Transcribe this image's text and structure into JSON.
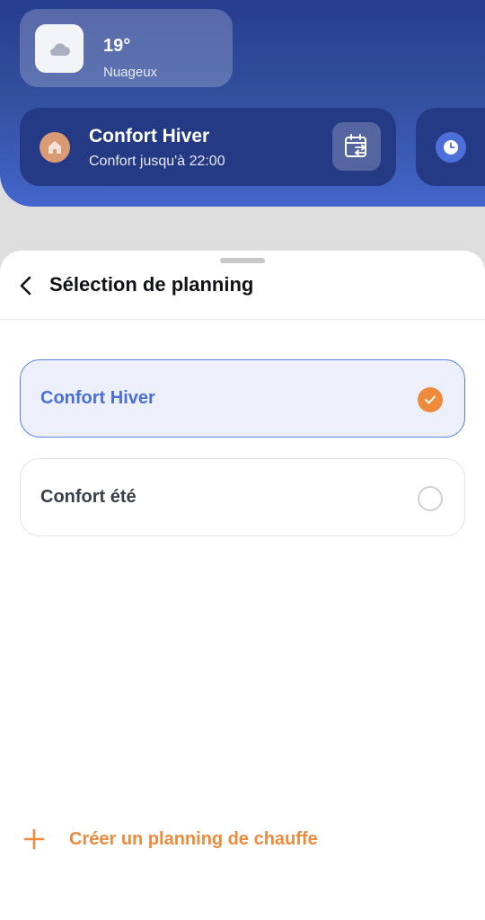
{
  "weather": {
    "temperature": "19°",
    "condition": "Nuageux",
    "icon": "cloud-icon"
  },
  "current_mode": {
    "title": "Confort Hiver",
    "subtitle": "Confort jusqu'à 22:00",
    "icon": "home-icon",
    "action_icon": "calendar-swap-icon"
  },
  "side_card": {
    "icon": "clock-icon"
  },
  "sheet": {
    "title": "Sélection de planning",
    "back_icon": "chevron-left-icon"
  },
  "options": [
    {
      "label": "Confort Hiver",
      "selected": true
    },
    {
      "label": "Confort été",
      "selected": false
    }
  ],
  "create": {
    "label": "Créer un planning de chauffe",
    "icon": "plus-icon"
  },
  "colors": {
    "header_blue": "#2f4a9c",
    "accent_blue": "#4a6fd9",
    "accent_orange": "#ee8a3c"
  }
}
